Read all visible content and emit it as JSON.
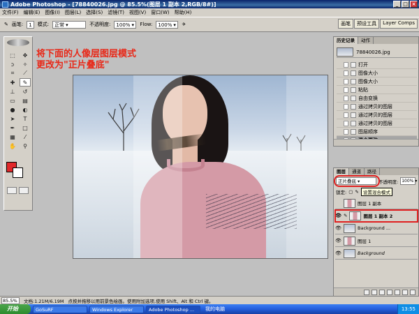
{
  "window": {
    "title": "Adobe Photoshop - [78840026.jpg @ 85.5%(图层 1 副本 2,RGB/8#)]",
    "controls": [
      "_",
      "□",
      "×"
    ]
  },
  "menu": [
    "文件(F)",
    "编辑(E)",
    "图像(I)",
    "图层(L)",
    "选择(S)",
    "滤镜(T)",
    "视图(V)",
    "窗口(W)",
    "帮助(H)"
  ],
  "options": {
    "brush_label": "画笔:",
    "brush_size": "1",
    "mode_label": "模式:",
    "mode_value": "正常",
    "opacity_label": "不透明度:",
    "opacity_value": "100%",
    "flow_label": "Flow:",
    "flow_value": "100%",
    "palette_tabs": [
      "画笔",
      "预设工具",
      "Layer Comps"
    ]
  },
  "annotation": "将下面的人像层图层模式更改为\"正片叠底\"",
  "history": {
    "tabs": [
      "历史记录",
      "动作"
    ],
    "snapshot_name": "78840026.jpg",
    "items": [
      "打开",
      "图像大小",
      "图像大小",
      "粘贴",
      "自由变换",
      "通过拷贝的图层",
      "通过拷贝的图层",
      "通过拷贝的图层",
      "图层顺序",
      "混合更改"
    ],
    "selected_index": 9
  },
  "layers": {
    "tabs": [
      "图层",
      "通道",
      "路径"
    ],
    "blend_mode": "正片叠底",
    "opacity_label": "不透明度:",
    "opacity_value": "100%",
    "lock_label": "锁定:",
    "tooltip": "设置混合模式",
    "items": [
      {
        "name": "图层 1 副本",
        "thumb": "person",
        "visible": false
      },
      {
        "name": "图层 1 副本 2",
        "thumb": "person",
        "visible": true,
        "active": true
      },
      {
        "name": "Background ...",
        "thumb": "landscape",
        "visible": true
      },
      {
        "name": "图层 1",
        "thumb": "person",
        "visible": true
      },
      {
        "name": "Background",
        "thumb": "landscape",
        "visible": true,
        "italic": true
      }
    ]
  },
  "status": {
    "zoom": "85.5%",
    "doc_info": "文档:1.21M/6.19M",
    "hint": "点按并拖移以用前景色绘画。使用附加选项,使用 Shift、Alt 和 Ctrl 键。"
  },
  "taskbar": {
    "start": "开始",
    "tasks": [
      "GoSuRF",
      "Windows Explorer",
      "Adobe Photoshop ..."
    ],
    "active_index": 2,
    "my_computer": "我的电脑",
    "clock": "13:55"
  },
  "colors": {
    "foreground": "#e0282a",
    "background": "#ffffff",
    "annotation": "#e82818",
    "highlight": "#e02020"
  }
}
